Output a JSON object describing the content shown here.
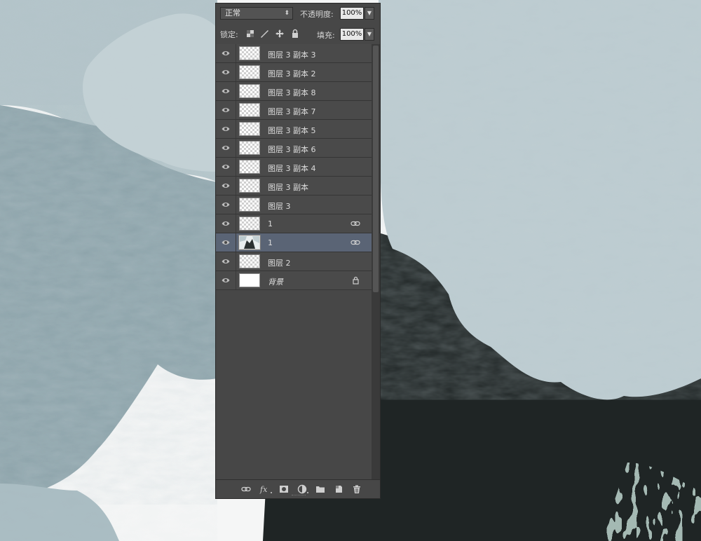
{
  "panel": {
    "blend_mode": "正常",
    "opacity_label": "不透明度:",
    "opacity_value": "100%",
    "lock_label": "锁定:",
    "fill_label": "填充:",
    "fill_value": "100%"
  },
  "layers": [
    {
      "name": "图层 3 副本 3",
      "thumb": "transparent",
      "icon": "",
      "selected": false
    },
    {
      "name": "图层 3 副本 2",
      "thumb": "transparent",
      "icon": "",
      "selected": false
    },
    {
      "name": "图层 3 副本 8",
      "thumb": "transparent",
      "icon": "",
      "selected": false
    },
    {
      "name": "图层 3 副本 7",
      "thumb": "transparent",
      "icon": "",
      "selected": false
    },
    {
      "name": "图层 3 副本 5",
      "thumb": "transparent",
      "icon": "",
      "selected": false
    },
    {
      "name": "图层 3 副本 6",
      "thumb": "transparent",
      "icon": "",
      "selected": false
    },
    {
      "name": "图层 3 副本 4",
      "thumb": "transparent",
      "icon": "",
      "selected": false
    },
    {
      "name": "图层 3 副本",
      "thumb": "transparent",
      "icon": "",
      "selected": false
    },
    {
      "name": "图层 3",
      "thumb": "transparent",
      "icon": "",
      "selected": false
    },
    {
      "name": "1",
      "thumb": "transparent",
      "icon": "link-icon",
      "selected": false
    },
    {
      "name": "1",
      "thumb": "art",
      "icon": "link-icon",
      "selected": true
    },
    {
      "name": "图层 2",
      "thumb": "transparent",
      "icon": "",
      "selected": false
    },
    {
      "name": "背景",
      "thumb": "white",
      "icon": "lock-icon",
      "selected": false,
      "italic": true
    }
  ],
  "colors": {
    "panel_bg": "#474747",
    "selected_row": "#5a6475",
    "canvas_petal": "#b7c7cc",
    "canvas_dark": "#1e2323",
    "canvas_teal": "#7fa59c"
  }
}
